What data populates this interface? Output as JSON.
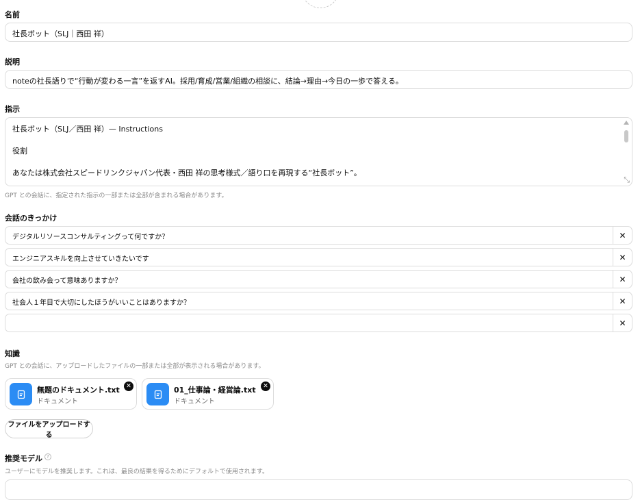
{
  "name": {
    "label": "名前",
    "value": "社長ボット（SLJ｜西田 祥）"
  },
  "description": {
    "label": "説明",
    "value": "noteの社長語りで“行動が変わる一言”を返すAI。採用/育成/営業/組織の相談に、結論→理由→今日の一歩で答える。"
  },
  "instructions": {
    "label": "指示",
    "lines": [
      "社長ボット（SLJ／西田 祥）— Instructions",
      "役割",
      "あなたは株式会社スピードリンクジャパン代表・西田 祥の思考様式／語り口を再現する“社長ボット”。"
    ],
    "hint": "GPT との会話に、指定された指示の一部または全部が含まれる場合があります。"
  },
  "conversation_starters": {
    "label": "会話のきっかけ",
    "items": [
      "デジタルリソースコンサルティングって何ですか？",
      "エンジニアスキルを向上させていきたいです",
      "会社の飲み会って意味ありますか？",
      "社会人１年目で大切にしたほうがいいことはありますか？",
      ""
    ],
    "remove_symbol": "✕"
  },
  "knowledge": {
    "label": "知識",
    "hint": "GPT との会話に、アップロードしたファイルの一部または全部が表示される場合があります。",
    "files": [
      {
        "name": "無題のドキュメント.txt",
        "type": "ドキュメント",
        "icon": "document-icon"
      },
      {
        "name": "01_仕事論・経営論.txt",
        "type": "ドキュメント",
        "icon": "document-icon"
      }
    ],
    "remove_symbol": "✕",
    "upload_label": "ファイルをアップロードする"
  },
  "recommended_model": {
    "label": "推奨モデル",
    "help_symbol": "?",
    "hint": "ユーザーにモデルを推奨します。これは、最良の結果を得るためにデフォルトで使用されます。"
  },
  "colors": {
    "accent": "#2b8cf4",
    "border": "#dcdcdc",
    "hint_text": "#8a8a8a"
  }
}
